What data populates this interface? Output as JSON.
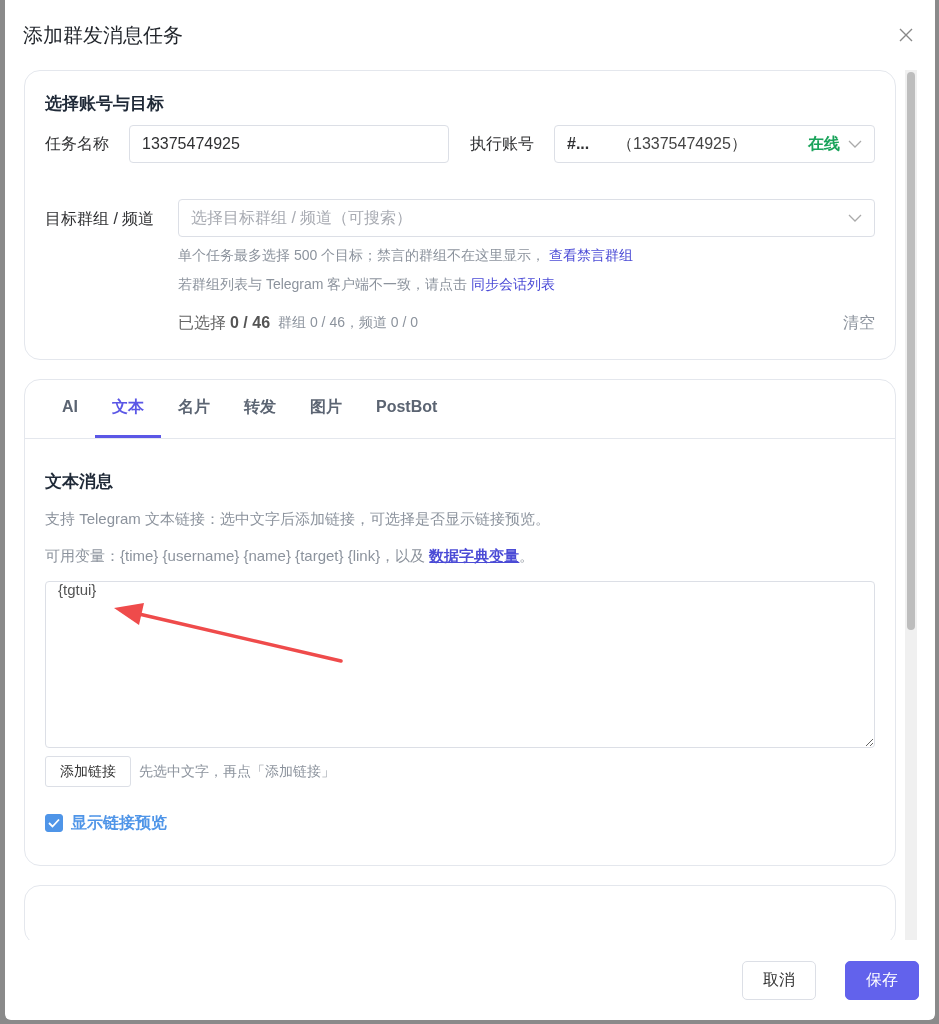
{
  "dialog": {
    "title": "添加群发消息任务"
  },
  "account_section": {
    "title": "选择账号与目标",
    "task_name": {
      "label": "任务名称",
      "value": "13375474925"
    },
    "account": {
      "label": "执行账号",
      "name": "#...",
      "phone": "（13375474925）",
      "status": "在线",
      "online": true
    },
    "targets": {
      "label": "目标群组 / 频道",
      "placeholder": "选择目标群组 / 频道（可搜索）",
      "hint_1": "单个任务最多选择 500 个目标；禁言的群组不在这里显示，",
      "hint_1_link": "查看禁言群组",
      "hint_2": "若群组列表与 Telegram 客户端不一致，请点击",
      "hint_2_link": "同步会话列表",
      "selected_label": "已选择",
      "selected_count": "0 / 46",
      "breakdown": "群组 0 / 46，频道 0 / 0",
      "clear": "清空"
    }
  },
  "tabs": [
    {
      "label": "AI",
      "selected": false
    },
    {
      "label": "文本",
      "selected": true
    },
    {
      "label": "名片",
      "selected": false
    },
    {
      "label": "转发",
      "selected": false
    },
    {
      "label": "图片",
      "selected": false
    },
    {
      "label": "PostBot",
      "selected": false
    }
  ],
  "text_message": {
    "title": "文本消息",
    "description": "支持 Telegram 文本链接：选中文字后添加链接，可选择是否显示链接预览。",
    "variables": "可用变量：{time} {username} {name} {target} {link}，以及",
    "variables_link": "数据字典变量",
    "variables_end": "。",
    "content": "{tgtui}",
    "add_link_button": "添加链接",
    "add_link_hint": "先选中文字，再点「添加链接」",
    "show_preview": {
      "label": "显示链接预览",
      "checked": true
    }
  },
  "buttons": [
    {
      "label": "取消",
      "kind": "secondary"
    },
    {
      "label": "保存",
      "kind": "primary"
    }
  ]
}
